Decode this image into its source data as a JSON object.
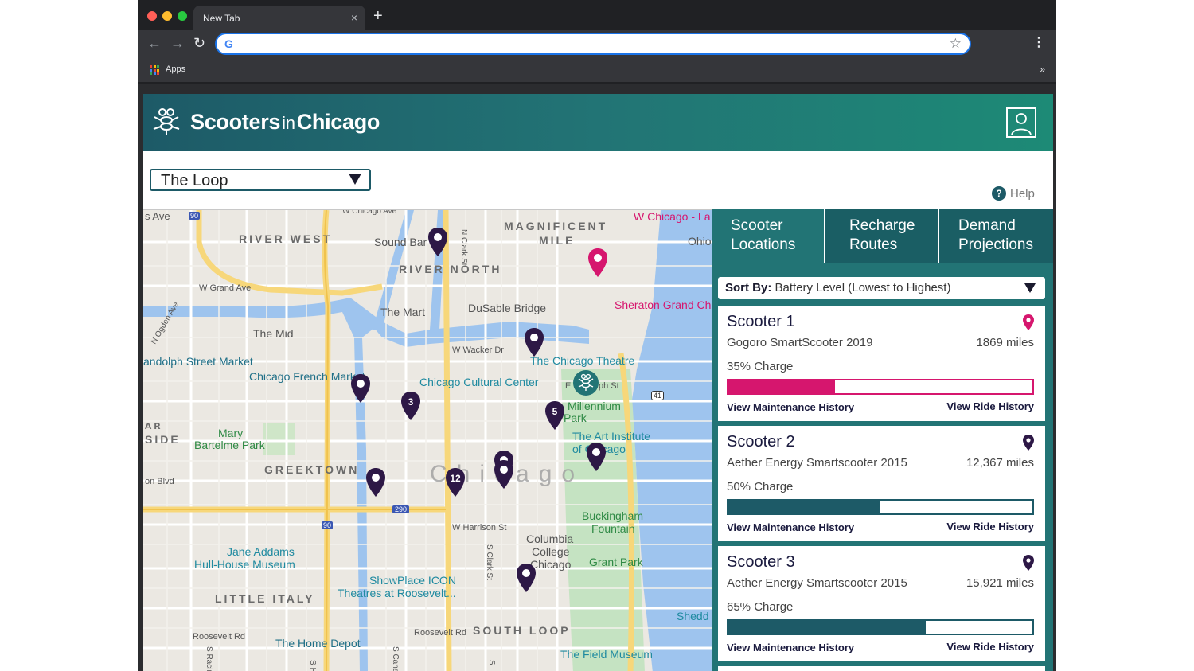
{
  "browser": {
    "tab_title": "New Tab",
    "tab_close": "×",
    "new_tab": "+",
    "back": "←",
    "forward": "→",
    "reload": "↻",
    "address_value": "",
    "bookmark_star": "☆",
    "menu": "⋮",
    "apps_label": "Apps",
    "more_bookmarks": "»"
  },
  "app": {
    "brand_left": "Scooters",
    "brand_mid": "in",
    "brand_right": "Chicago",
    "location": "The Loop",
    "help": "Help",
    "help_icon": "?"
  },
  "map": {
    "neighborhoods": [
      "RIVER WEST",
      "MAGNIFICENT",
      "MILE",
      "RIVER NORTH",
      "GREEKTOWN",
      "LITTLE ITALY",
      "SOUTH LOOP",
      "ᴀʀ",
      "SIDE"
    ],
    "streets": [
      "s Ave",
      "W Chicago Ave",
      "N Clark St",
      "W Grand Ave",
      "N Ogden Ave",
      "W Wacker Dr",
      "E",
      "ph St",
      "on Blvd",
      "W Harrison St",
      "S Clark St",
      "Roosevelt Rd",
      "Roosevelt Rd",
      "S Canal",
      "S Racine",
      "S H",
      "S",
      "W Chicago - La"
    ],
    "pois": [
      "Sound Bar",
      "The Mart",
      "DuSable Bridge",
      "The Mid",
      "andolph Street Market",
      "Chicago French Market",
      "Chicago Cultural Center",
      "The Chicago Theatre",
      "Millennium",
      "Park",
      "The Art Institute",
      "of Chicago",
      "Mary",
      "Bartelme Park",
      "Buckingham",
      "Fountain",
      "Columbia",
      "College",
      "Chicago",
      "Grant Park",
      "Jane Addams",
      "Hull-House Museum",
      "ShowPlace ICON",
      "Theatres at Roosevelt...",
      "Shedd",
      "The Home Depot",
      "The Field Museum",
      "Sheraton Grand Chi",
      "Ohio"
    ],
    "city_label": "Chicago",
    "route_shields": [
      "90",
      "41",
      "290",
      "90"
    ],
    "cluster_counts": [
      "3",
      "5",
      "12"
    ]
  },
  "panel": {
    "tabs": [
      {
        "line1": "Scooter",
        "line2": "Locations"
      },
      {
        "line1": "Recharge",
        "line2": "Routes"
      },
      {
        "line1": "Demand",
        "line2": "Projections"
      }
    ],
    "sort_label": "Sort By:",
    "sort_value": "Battery Level (Lowest to Highest)",
    "scooters": [
      {
        "name": "Scooter 1",
        "model": "Gogoro SmartScooter 2019",
        "miles": "1869 miles",
        "charge": "35% Charge",
        "charge_fraction": 0.35,
        "color": "#d6166e",
        "maintenance": "View Maintenance History",
        "rides": "View Ride History"
      },
      {
        "name": "Scooter 2",
        "model": "Aether Energy Smartscooter 2015",
        "miles": "12,367 miles",
        "charge": "50% Charge",
        "charge_fraction": 0.5,
        "color": "#1d5a67",
        "maintenance": "View Maintenance History",
        "rides": "View Ride History"
      },
      {
        "name": "Scooter 3",
        "model": "Aether Energy Smartscooter 2015",
        "miles": "15,921 miles",
        "charge": "65% Charge",
        "charge_fraction": 0.65,
        "color": "#1d5a67",
        "maintenance": "View Maintenance History",
        "rides": "View Ride History"
      }
    ]
  },
  "colors": {
    "accent": "#227475",
    "header_dark": "#1d5a67",
    "pin_purple": "#2d1846",
    "pin_magenta": "#d6166e"
  }
}
